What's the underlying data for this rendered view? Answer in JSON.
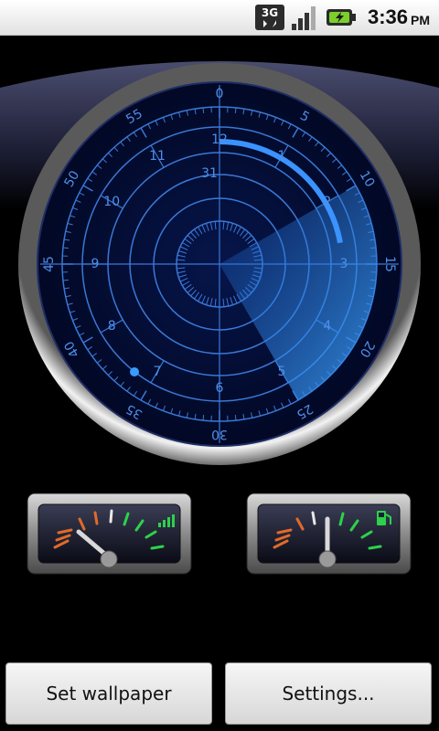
{
  "status_bar": {
    "network_type": "3G",
    "time": "3:36",
    "ampm": "PM",
    "icons": [
      "network-3g-icon",
      "signal-strength-icon",
      "battery-charging-icon"
    ]
  },
  "radar": {
    "outer_labels": [
      "0",
      "5",
      "10",
      "15",
      "20",
      "25",
      "30",
      "35",
      "40",
      "45",
      "50",
      "55"
    ],
    "hour_labels": [
      "12",
      "1",
      "2",
      "3",
      "4",
      "5",
      "6",
      "7",
      "8",
      "9",
      "10",
      "11"
    ],
    "day_label": "31",
    "colors": {
      "accent": "#2a8cff",
      "dial_bg": "#04102e",
      "ring": "#3a78d6"
    }
  },
  "gauges": {
    "left": {
      "type": "signal",
      "icon": "signal-bars-icon",
      "level": 0.15
    },
    "right": {
      "type": "fuel",
      "icon": "fuel-pump-icon",
      "level": 0.5
    }
  },
  "buttons": {
    "set_wallpaper": "Set wallpaper",
    "settings": "Settings..."
  }
}
